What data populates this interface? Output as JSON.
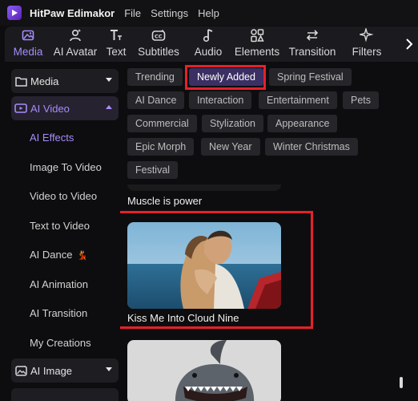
{
  "app": {
    "title": "HitPaw Edimakor",
    "menu": [
      "File",
      "Settings",
      "Help"
    ]
  },
  "toolbar": {
    "items": [
      {
        "label": "Media",
        "icon": "media-icon",
        "active": true
      },
      {
        "label": "AI Avatar",
        "icon": "avatar-icon"
      },
      {
        "label": "Text",
        "icon": "text-icon"
      },
      {
        "label": "Subtitles",
        "icon": "subtitles-icon"
      },
      {
        "label": "Audio",
        "icon": "audio-icon"
      },
      {
        "label": "Elements",
        "icon": "elements-icon"
      },
      {
        "label": "Transition",
        "icon": "transition-icon"
      },
      {
        "label": "Filters",
        "icon": "filters-icon"
      }
    ],
    "next_icon": "chevron-right-icon"
  },
  "sidebar": {
    "media": {
      "label": "Media",
      "icon": "folder-icon"
    },
    "ai_video": {
      "label": "AI Video",
      "icon": "ai-video-icon"
    },
    "items": [
      {
        "label": "AI Effects",
        "active": true
      },
      {
        "label": "Image To Video"
      },
      {
        "label": "Video to Video"
      },
      {
        "label": "Text to Video"
      },
      {
        "label": "AI Dance",
        "emoji": "💃"
      },
      {
        "label": "AI Animation"
      },
      {
        "label": "AI Transition"
      },
      {
        "label": "My Creations"
      }
    ],
    "ai_image": {
      "label": "AI Image",
      "icon": "ai-image-icon"
    }
  },
  "filters": {
    "chips": [
      "Trending",
      "Newly Added",
      "Spring Festival",
      "AI Dance",
      "Interaction",
      "Entertainment",
      "Pets",
      "Commercial",
      "Stylization",
      "Appearance",
      "Epic Morph",
      "New Year",
      "Winter Christmas",
      "Festival"
    ],
    "selected": "Newly Added"
  },
  "effects": {
    "prev_title": "Muscle is power",
    "card_title": "Kiss Me Into Cloud Nine"
  },
  "colors": {
    "accent": "#a78bfa",
    "highlight": "#e5212b",
    "chip_bg": "#26262a",
    "selected_chip_bg": "#3b2f63"
  }
}
